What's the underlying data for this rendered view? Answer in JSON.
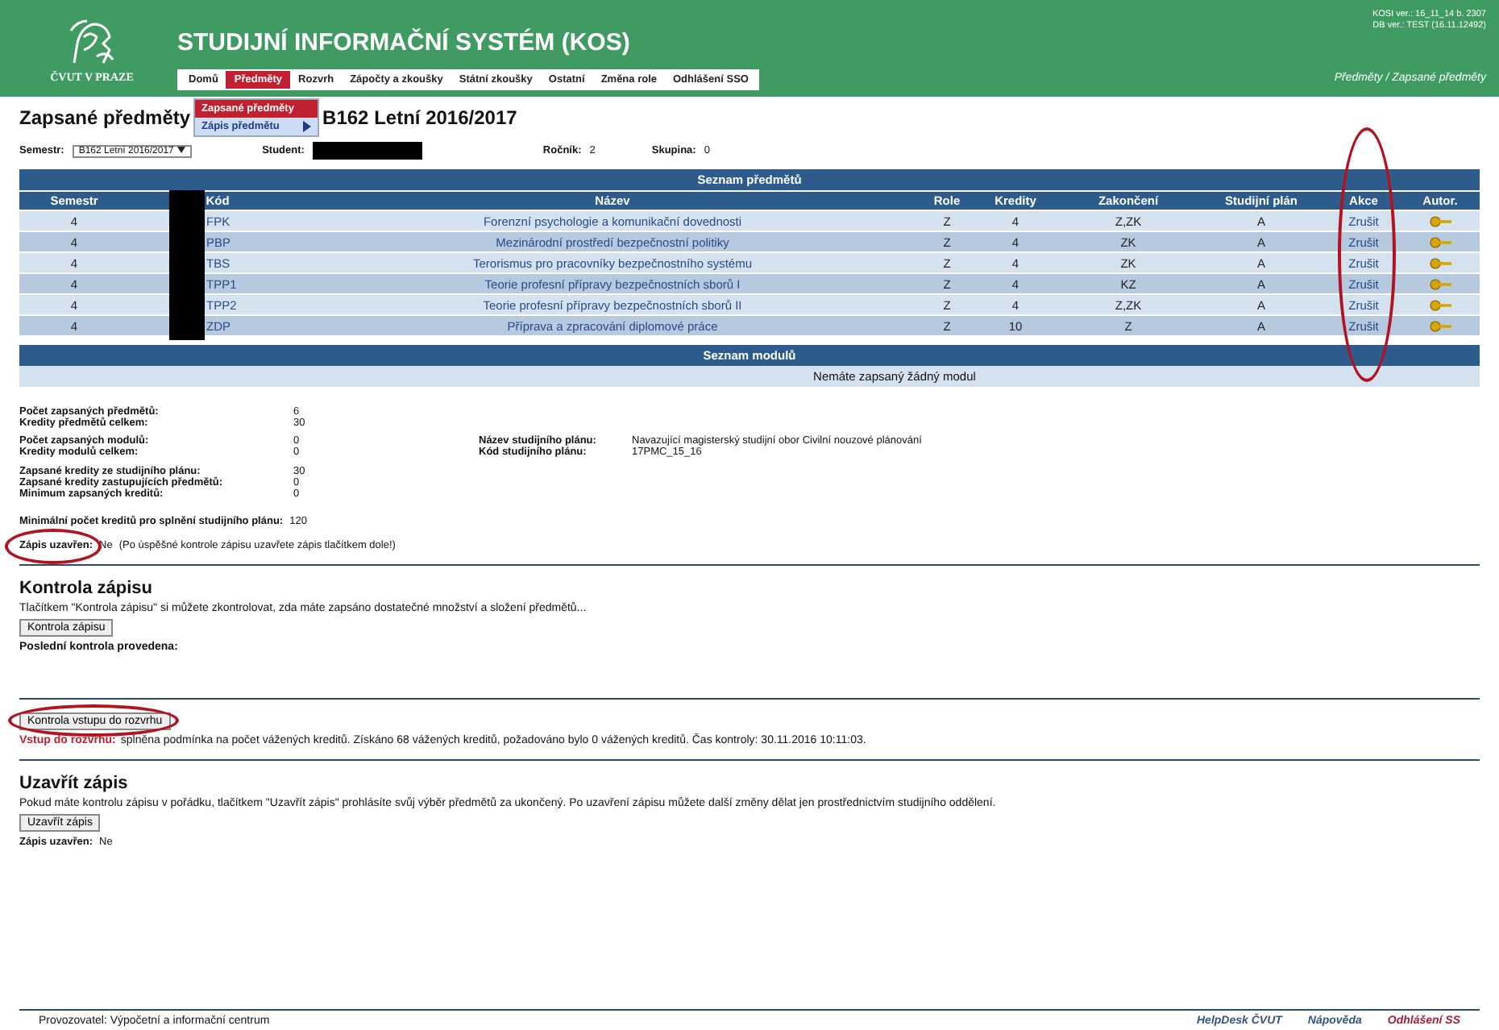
{
  "header": {
    "logo_text": "ČVUT V PRAZE",
    "title": "STUDIJNÍ INFORMAČNÍ SYSTÉM (KOS)",
    "version_lines": [
      "KOSI ver.: 16_11_14 b. 2307",
      "DB ver.: TEST (16.11.12492)"
    ],
    "breadcrumb": "Předměty / Zapsané předměty",
    "nav": [
      {
        "label": "Domů",
        "selected": false
      },
      {
        "label": "Předměty",
        "selected": true
      },
      {
        "label": "Rozvrh",
        "selected": false
      },
      {
        "label": "Zápočty a zkoušky",
        "selected": false
      },
      {
        "label": "Státní zkoušky",
        "selected": false
      },
      {
        "label": "Ostatní",
        "selected": false
      },
      {
        "label": "Změna role",
        "selected": false
      },
      {
        "label": "Odhlášení SSO",
        "selected": false
      }
    ]
  },
  "dropdown": {
    "items": [
      {
        "label": "Zapsané předměty",
        "selected": true,
        "has_submenu": false
      },
      {
        "label": "Zápis předmětu",
        "selected": false,
        "has_submenu": true
      }
    ]
  },
  "page_title": {
    "left": "Zapsané předměty",
    "right": "B162 Letní 2016/2017"
  },
  "filters": {
    "semester_label": "Semestr:",
    "semester_value": "B162 Letní 2016/2017",
    "student_label": "Student:",
    "year_label": "Ročník:",
    "year_value": "2",
    "group_label": "Skupina:",
    "group_value": "0"
  },
  "table": {
    "title": "Seznam předmětů",
    "columns": [
      "Semestr",
      "Kód",
      "Název",
      "Role",
      "Kredity",
      "Zakončení",
      "Studijní plán",
      "Akce",
      "Autor."
    ],
    "rows": [
      {
        "semestr": "4",
        "kod": "FPK",
        "nazev": "Forenzní psychologie a komunikační dovednosti",
        "role": "Z",
        "kredity": "4",
        "zakonceni": "Z,ZK",
        "plan": "A",
        "akce": "Zrušit"
      },
      {
        "semestr": "4",
        "kod": "PBP",
        "nazev": "Mezinárodní prostředí bezpečnostní politiky",
        "role": "Z",
        "kredity": "4",
        "zakonceni": "ZK",
        "plan": "A",
        "akce": "Zrušit"
      },
      {
        "semestr": "4",
        "kod": "TBS",
        "nazev": "Terorismus pro pracovníky bezpečnostního systému",
        "role": "Z",
        "kredity": "4",
        "zakonceni": "ZK",
        "plan": "A",
        "akce": "Zrušit"
      },
      {
        "semestr": "4",
        "kod": "TPP1",
        "nazev": "Teorie profesní přípravy bezpečnostních sborů I",
        "role": "Z",
        "kredity": "4",
        "zakonceni": "KZ",
        "plan": "A",
        "akce": "Zrušit"
      },
      {
        "semestr": "4",
        "kod": "TPP2",
        "nazev": "Teorie profesní přípravy bezpečnostních sborů II",
        "role": "Z",
        "kredity": "4",
        "zakonceni": "Z,ZK",
        "plan": "A",
        "akce": "Zrušit"
      },
      {
        "semestr": "4",
        "kod": "ZDP",
        "nazev": "Příprava a zpracování diplomové práce",
        "role": "Z",
        "kredity": "10",
        "zakonceni": "Z",
        "plan": "A",
        "akce": "Zrušit"
      }
    ]
  },
  "modules": {
    "title": "Seznam modulů",
    "empty_text": "Nemáte zapsaný žádný modul"
  },
  "stats": [
    [
      {
        "label": "Počet zapsaných předmětů:",
        "value": "6"
      },
      {
        "label": "Kredity předmětů celkem:",
        "value": "30"
      }
    ],
    [
      {
        "label": "Počet zapsaných modulů:",
        "value": "0"
      },
      {
        "label": "Kredity modulů celkem:",
        "value": "0"
      }
    ],
    [
      {
        "label": "Zapsané kredity ze studijního plánu:",
        "value": "30"
      },
      {
        "label": "Zapsané kredity zastupujících předmětů:",
        "value": "0"
      },
      {
        "label": "Minimum zapsaných kreditů:",
        "value": "0"
      }
    ]
  ],
  "plan_info": [
    {
      "label": "Název studijního plánu:",
      "value": "Navazující magisterský studijní obor Civilní nouzové plánování"
    },
    {
      "label": "Kód studijního plánu:",
      "value": "17PMC_15_16"
    }
  ],
  "min_credits": {
    "label": "Minimální počet kreditů pro splnění studijního plánu:",
    "value": "120"
  },
  "closed_status": {
    "label": "Zápis uzavřen:",
    "value": "Ne",
    "note": "(Po úspěšné kontrole zápisu uzavřete zápis tlačítkem dole!)"
  },
  "check_section": {
    "heading": "Kontrola zápisu",
    "text": "Tlačítkem \"Kontrola zápisu\" si můžete zkontrolovat, zda máte zapsáno dostatečné množství a složení předmětů...",
    "button": "Kontrola zápisu",
    "last_label": "Poslední kontrola provedena:"
  },
  "schedule_section": {
    "button": "Kontrola vstupu do rozvrhu",
    "result_label": "Vstup do rozvrhu:",
    "result_text": "splněna podmínka na počet vážených kreditů. Získáno 68 vážených kreditů, požadováno bylo 0 vážených kreditů. Čas kontroly: 30.11.2016 10:11:03."
  },
  "close_section": {
    "heading": "Uzavřít zápis",
    "text": "Pokud máte kontrolu zápisu v pořádku, tlačítkem \"Uzavřít zápis\" prohlásíte svůj výběr předmětů za ukončený. Po uzavření zápisu můžete další změny dělat jen prostřednictvím studijního oddělení.",
    "button": "Uzavřít zápis",
    "status_label": "Zápis uzavřen:",
    "status_value": "Ne"
  },
  "footer": {
    "operator": "Provozovatel: Výpočetní a informační centrum",
    "links": [
      "HelpDesk ČVUT",
      "Nápověda",
      "Odhlášení SS"
    ]
  }
}
